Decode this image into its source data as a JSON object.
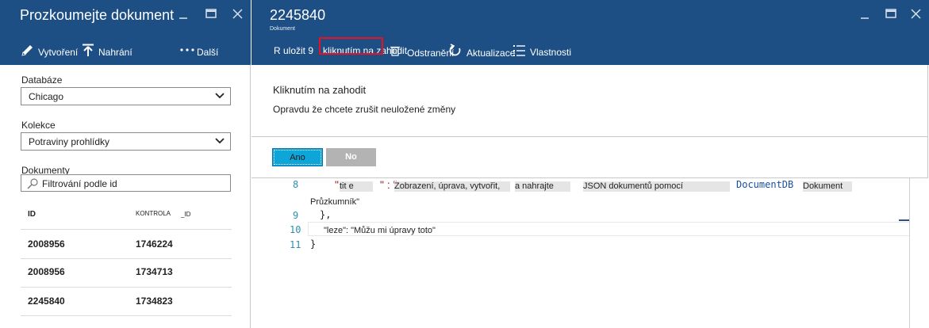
{
  "left_blade": {
    "title": "Prozkoumejte dokument",
    "toolbar": {
      "create_label": "Vytvoření",
      "upload_label": "Nahrání",
      "more_label": "Další"
    },
    "database": {
      "label": "Databáze",
      "selected": "Chicago"
    },
    "collection": {
      "label": "Kolekce",
      "selected": "Potraviny prohlídky"
    },
    "documents": {
      "label": "Dokumenty",
      "filter_placeholder": "Filtrování podle id"
    },
    "table": {
      "headers": [
        "ID",
        "KONTROLA",
        "_ID"
      ],
      "rows": [
        [
          "2008956",
          "1746224"
        ],
        [
          "2008956",
          "1734713"
        ],
        [
          "2245840",
          "1734823"
        ]
      ]
    }
  },
  "document_blade": {
    "title": "2245840",
    "subtitle": "Dokument",
    "toolbar": {
      "save_label": "R uložit 9",
      "discard_label": "kliknutím na zahodit",
      "delete_label": "Odstranění",
      "refresh_label": "Aktualizace",
      "properties_label": "Vlastnosti"
    }
  },
  "dialog": {
    "title": "Kliknutím na zahodit",
    "message": "Opravdu že chcete zrušit neuložené změny",
    "yes_label": "Ano",
    "no_label": "No"
  },
  "editor": {
    "lines": [
      {
        "number": "8",
        "key": "tit e",
        "value_parts": [
          "Zobrazení, úprava, vytvořit,",
          "a nahrajte",
          "JSON dokumentů pomocí",
          "DocumentDB",
          "Dokument"
        ],
        "wrap": "Průzkumník\""
      },
      {
        "number": "9",
        "text": "},"
      },
      {
        "number": "10",
        "text": "\"leze\": \"Můžu mi úpravy toto\""
      },
      {
        "number": "11",
        "text": "}"
      }
    ]
  },
  "colors": {
    "header_bg": "#1d4f85",
    "highlight": "#e81123",
    "primary_button": "#0ea5d8",
    "disabled_button": "#b3b3b3",
    "line_number": "#2b91af"
  },
  "icons": [
    "minimize-icon",
    "maximize-icon",
    "close-icon",
    "pencil-icon",
    "upload-icon",
    "more-icon",
    "chevron-down-icon",
    "search-icon",
    "trash-icon",
    "refresh-icon",
    "list-icon"
  ]
}
